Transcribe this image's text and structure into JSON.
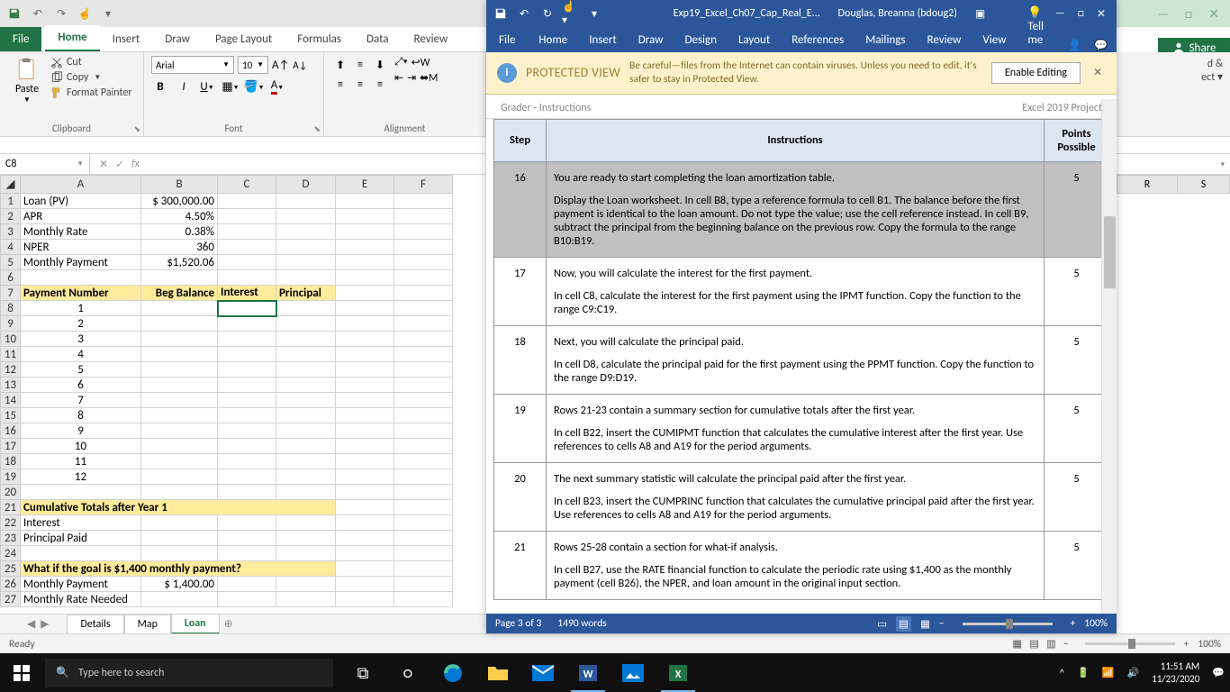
{
  "excel": {
    "tabs": {
      "file": "File",
      "home": "Home",
      "insert": "Insert",
      "draw": "Draw",
      "pagelayout": "Page Layout",
      "formulas": "Formulas",
      "data": "Data",
      "review": "Review"
    },
    "clipboard": {
      "paste": "Paste",
      "cut": "Cut",
      "copy": "Copy",
      "fmtpainter": "Format Painter",
      "label": "Clipboard"
    },
    "font": {
      "name": "Arial",
      "size": "10",
      "label": "Font"
    },
    "alignment": {
      "label": "Alignment"
    },
    "namebox": "C8",
    "cols": [
      "A",
      "B",
      "C",
      "D",
      "E",
      "F"
    ],
    "colsR": [
      "R",
      "S"
    ],
    "rows": [
      {
        "r": "1",
        "A": "Loan (PV)",
        "B": "$ 300,000.00"
      },
      {
        "r": "2",
        "A": "APR",
        "B": "4.50%"
      },
      {
        "r": "3",
        "A": "Monthly Rate",
        "B": "0.38%"
      },
      {
        "r": "4",
        "A": "NPER",
        "B": "360"
      },
      {
        "r": "5",
        "A": "Monthly Payment",
        "B": "$1,520.06"
      },
      {
        "r": "6"
      },
      {
        "r": "7",
        "hdr": true,
        "A": "Payment Number",
        "B": "Beg Balance",
        "C": "Interest",
        "D": "Principal"
      },
      {
        "r": "8",
        "Ac": "1",
        "selC": true
      },
      {
        "r": "9",
        "Ac": "2"
      },
      {
        "r": "10",
        "Ac": "3"
      },
      {
        "r": "11",
        "Ac": "4"
      },
      {
        "r": "12",
        "Ac": "5"
      },
      {
        "r": "13",
        "Ac": "6"
      },
      {
        "r": "14",
        "Ac": "7"
      },
      {
        "r": "15",
        "Ac": "8"
      },
      {
        "r": "16",
        "Ac": "9"
      },
      {
        "r": "17",
        "Ac": "10"
      },
      {
        "r": "18",
        "Ac": "11"
      },
      {
        "r": "19",
        "Ac": "12"
      },
      {
        "r": "20"
      },
      {
        "r": "21",
        "hdr": true,
        "A": "Cumulative Totals after Year 1"
      },
      {
        "r": "22",
        "A": "Interest"
      },
      {
        "r": "23",
        "A": "Principal Paid"
      },
      {
        "r": "24"
      },
      {
        "r": "25",
        "hdr": true,
        "A": "What if the goal is $1,400 monthly payment?"
      },
      {
        "r": "26",
        "A": "Monthly Payment",
        "B": "$    1,400.00"
      },
      {
        "r": "27",
        "A": "Monthly Rate Needed"
      }
    ],
    "sheets": [
      "Details",
      "Map",
      "Loan"
    ],
    "activeSheet": "Loan",
    "share": "Share",
    "ready": "Ready",
    "zoom": "100%",
    "editGrp": {
      "a": "d &",
      "b": "ect"
    }
  },
  "word": {
    "filename": "Exp19_Excel_Ch07_Cap_Real_E...",
    "user": "Douglas, Breanna (bdoug2)",
    "tabs": {
      "file": "File",
      "home": "Home",
      "insert": "Insert",
      "draw": "Draw",
      "design": "Design",
      "layout": "Layout",
      "references": "References",
      "mailings": "Mailings",
      "review": "Review",
      "view": "View",
      "tellme": "Tell me"
    },
    "pv": {
      "label": "PROTECTED VIEW",
      "msg": "Be careful—files from the Internet can contain viruses. Unless you need to edit, it's safer to stay in Protected View.",
      "enable": "Enable Editing"
    },
    "docheader": {
      "left": "Grader - Instructions",
      "right": "Excel 2019 Project"
    },
    "table": {
      "hStep": "Step",
      "hInstr": "Instructions",
      "hPts": "Points Possible",
      "rows": [
        {
          "step": "16",
          "pts": "5",
          "hl": true,
          "paras": [
            "You are ready to start completing the loan amortization table.",
            "Display the Loan worksheet. In cell B8, type a reference formula to cell B1. The balance before the first payment is identical to the loan amount. Do not type the value; use the cell reference instead. In cell B9, subtract the principal from the beginning balance on the previous row. Copy the formula to the range B10:B19."
          ]
        },
        {
          "step": "17",
          "pts": "5",
          "paras": [
            "Now, you will calculate the interest for the first payment.",
            "In cell C8, calculate the interest for the first payment using the IPMT function. Copy the function to the range C9:C19."
          ]
        },
        {
          "step": "18",
          "pts": "5",
          "paras": [
            "Next, you will calculate the principal paid.",
            "In cell D8, calculate the principal paid for the first payment using the PPMT function. Copy the function to the range D9:D19."
          ]
        },
        {
          "step": "19",
          "pts": "5",
          "paras": [
            "Rows 21-23 contain a summary section for cumulative totals after the first year.",
            "In cell B22, insert the CUMIPMT function that calculates the cumulative interest after the first year. Use references to cells A8 and A19 for the period arguments."
          ]
        },
        {
          "step": "20",
          "pts": "5",
          "paras": [
            "The next summary statistic will calculate the principal paid after the first year.",
            "In cell B23, insert the CUMPRINC function that calculates the cumulative principal paid after the first year. Use references to cells A8 and A19 for the period arguments."
          ]
        },
        {
          "step": "21",
          "pts": "5",
          "paras": [
            "Rows 25-28 contain a section for what-if analysis.",
            "In cell B27, use the RATE financial function to calculate the periodic rate using $1,400 as the monthly payment (cell B26), the NPER, and loan amount in the original input section."
          ]
        }
      ]
    },
    "status": {
      "page": "Page 3 of 3",
      "words": "1490 words",
      "zoom": "100%"
    }
  },
  "taskbar": {
    "search": "Type here to search",
    "time": "11:51 AM",
    "date": "11/23/2020"
  }
}
